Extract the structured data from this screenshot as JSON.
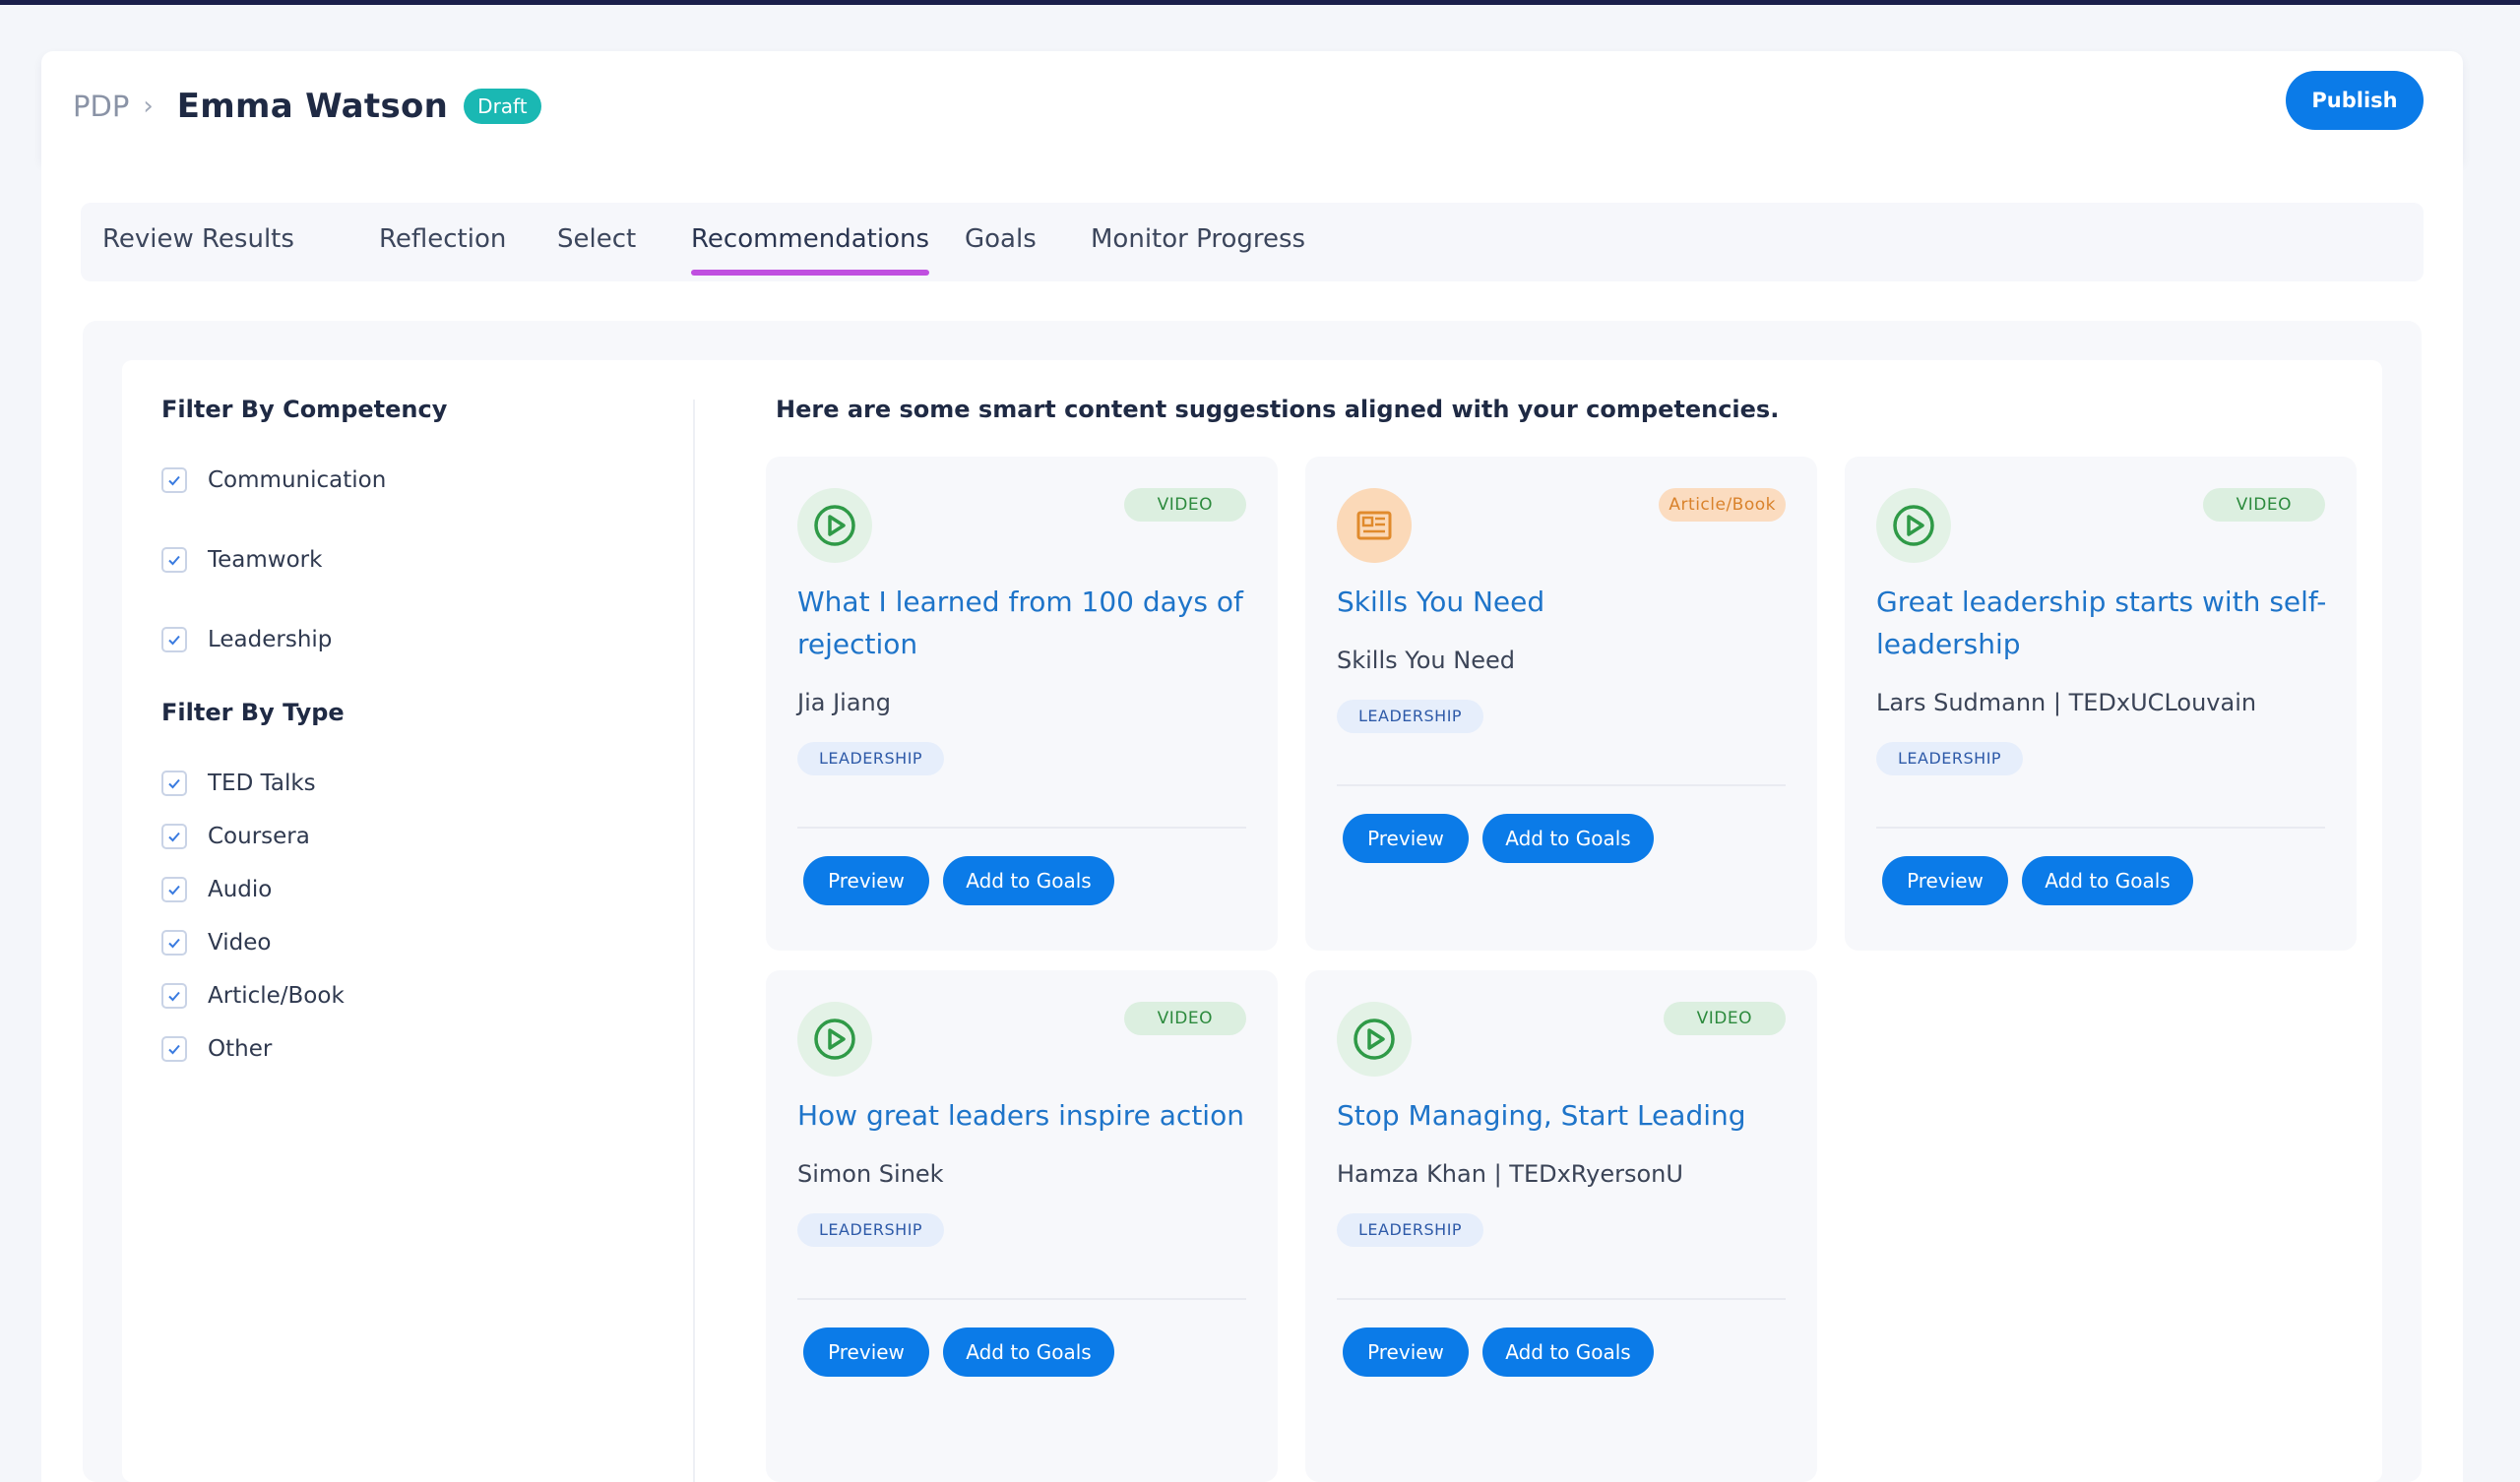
{
  "header": {
    "breadcrumb_root": "PDP",
    "breadcrumb_sep": "›",
    "title": "Emma Watson",
    "status_badge": "Draft",
    "publish_label": "Publish"
  },
  "tabs": [
    {
      "label": "Review Results"
    },
    {
      "label": "Reflection"
    },
    {
      "label": "Select"
    },
    {
      "label": "Recommendations",
      "active": true
    },
    {
      "label": "Goals"
    },
    {
      "label": "Monitor Progress"
    }
  ],
  "filters": {
    "competency_heading": "Filter By Competency",
    "competencies": [
      {
        "label": "Communication",
        "checked": true
      },
      {
        "label": "Teamwork",
        "checked": true
      },
      {
        "label": "Leadership",
        "checked": true
      }
    ],
    "type_heading": "Filter By Type",
    "types": [
      {
        "label": "TED Talks",
        "checked": true
      },
      {
        "label": "Coursera",
        "checked": true
      },
      {
        "label": "Audio",
        "checked": true
      },
      {
        "label": "Video",
        "checked": true
      },
      {
        "label": "Article/Book",
        "checked": true
      },
      {
        "label": "Other",
        "checked": true
      }
    ]
  },
  "suggestions_heading": "Here are some smart content suggestions aligned with your competencies.",
  "cards": [
    {
      "icon": "play-circle-icon",
      "type": "VIDEO",
      "title": "What I learned from 100 days of rejection",
      "author": "Jia Jiang",
      "tag": "LEADERSHIP",
      "preview_label": "Preview",
      "add_label": "Add to Goals"
    },
    {
      "icon": "article-icon",
      "type": "Article/Book",
      "title": "Skills You Need",
      "author": "Skills You Need",
      "tag": "LEADERSHIP",
      "preview_label": "Preview",
      "add_label": "Add to Goals"
    },
    {
      "icon": "play-circle-icon",
      "type": "VIDEO",
      "title": "Great leadership starts with self-leadership",
      "author": "Lars Sudmann | TEDxUCLouvain",
      "tag": "LEADERSHIP",
      "preview_label": "Preview",
      "add_label": "Add to Goals"
    },
    {
      "icon": "play-circle-icon",
      "type": "VIDEO",
      "title": "How great leaders inspire action",
      "author": "Simon Sinek",
      "tag": "LEADERSHIP",
      "preview_label": "Preview",
      "add_label": "Add to Goals"
    },
    {
      "icon": "play-circle-icon",
      "type": "VIDEO",
      "title": "Stop Managing, Start Leading",
      "author": "Hamza Khan | TEDxRyersonU",
      "tag": "LEADERSHIP",
      "preview_label": "Preview",
      "add_label": "Add to Goals"
    }
  ],
  "colors": {
    "primary": "#0b7be8",
    "draft": "#1ab8b3",
    "tab_active_underline": "#c04fe0",
    "title_link": "#1e74c9",
    "video_green": "#2c8a3d",
    "article_orange": "#d9822b"
  }
}
